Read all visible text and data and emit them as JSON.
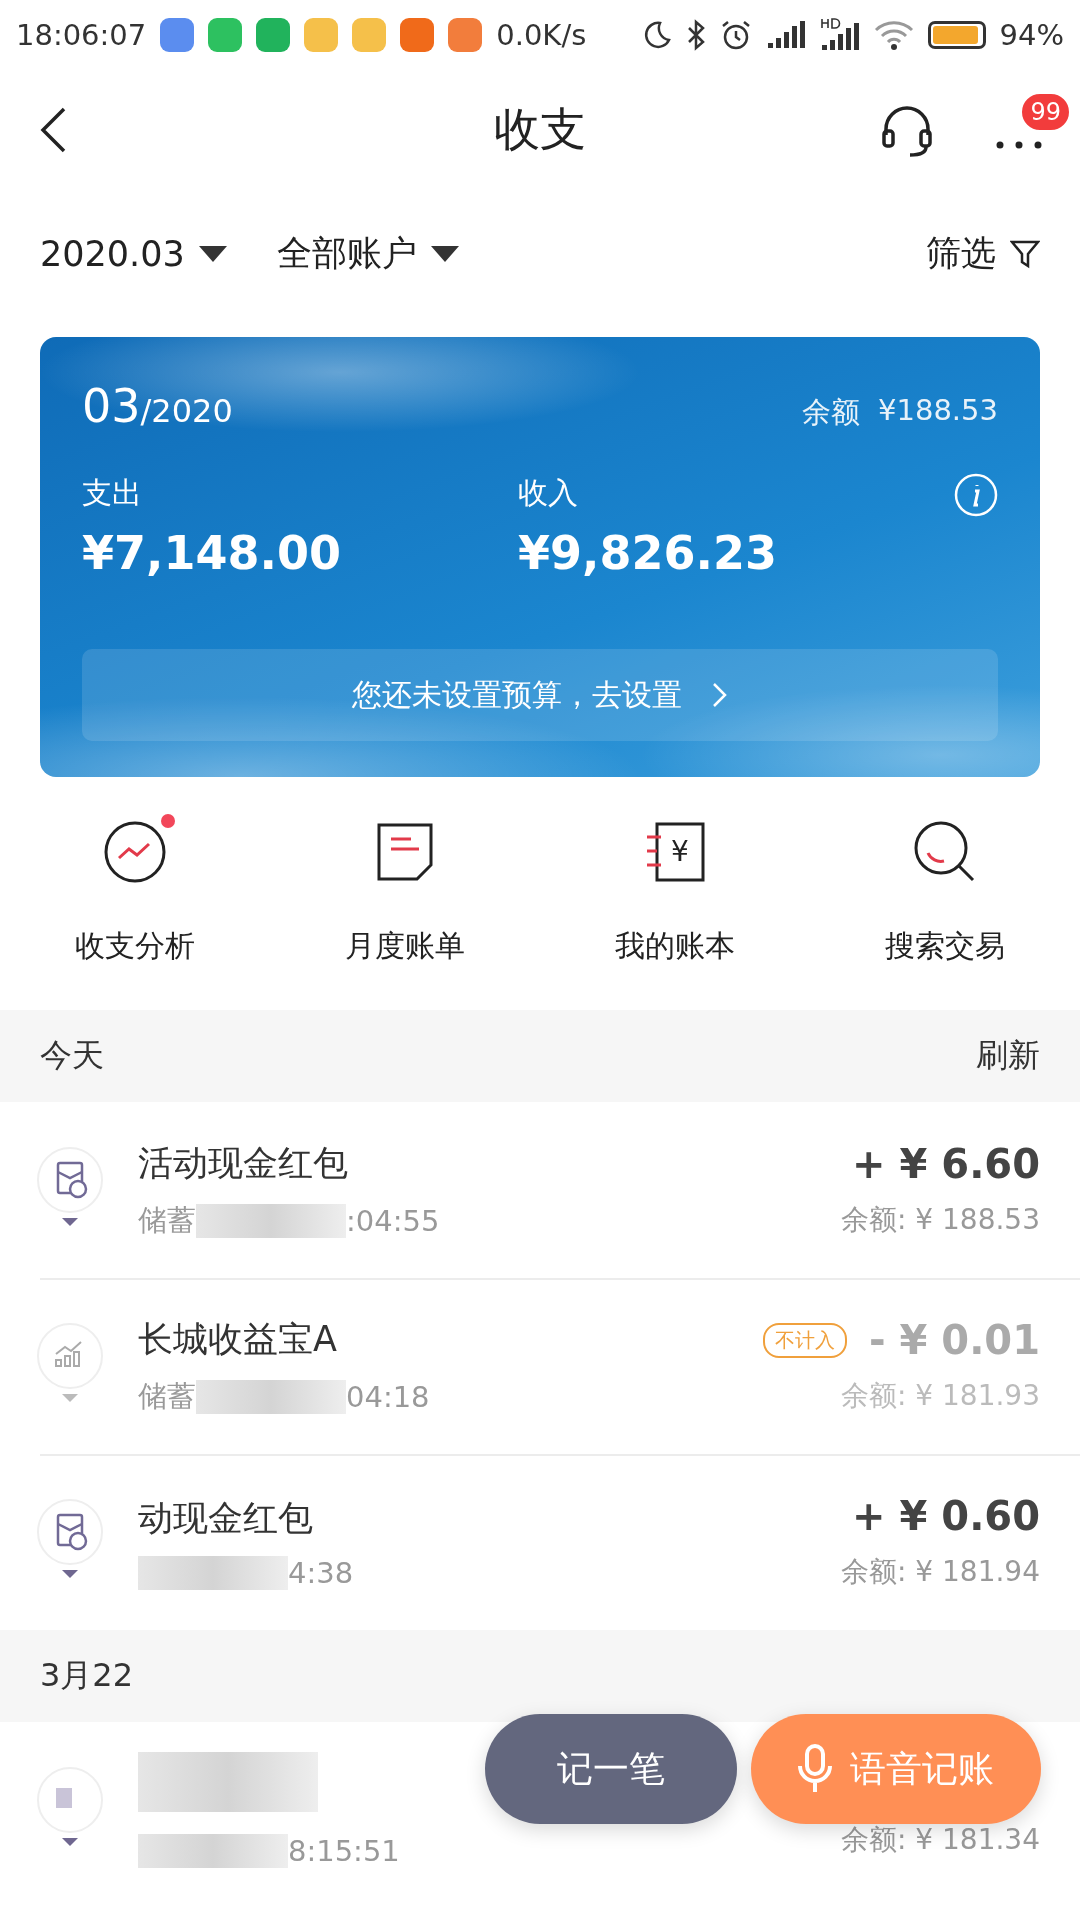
{
  "status_bar": {
    "time": "18:06:07",
    "speed": "0.0K/s",
    "battery_text": "94%",
    "battery": {
      "level": 0.94
    }
  },
  "header": {
    "title": "收支",
    "more_badge": "99"
  },
  "filters": {
    "month": "2020.03",
    "account": "全部账户",
    "filter_label": "筛选"
  },
  "summary": {
    "month": "03",
    "year": "/2020",
    "balance_label": "余额",
    "balance": "¥188.53",
    "expense_label": "支出",
    "expense": "¥7,148.00",
    "income_label": "收入",
    "income": "¥9,826.23",
    "budget_prompt": "您还未设置预算，去设置"
  },
  "quick_actions": [
    {
      "kind": "analysis",
      "label": "收支分析",
      "dot": true
    },
    {
      "kind": "bill",
      "label": "月度账单",
      "dot": false
    },
    {
      "kind": "ledger",
      "label": "我的账本",
      "dot": false,
      "icon_text": "¥"
    },
    {
      "kind": "search",
      "label": "搜索交易",
      "dot": false
    }
  ],
  "sections": [
    {
      "title": "今天",
      "action": "刷新",
      "transactions": [
        {
          "kind": "red-packet",
          "title": "活动现金红包",
          "account": "储蓄",
          "time": ":04:55",
          "amount": "+ ¥ 6.60",
          "balance": "余额: ¥ 188.53",
          "excluded": false
        },
        {
          "kind": "chart",
          "title": "长城收益宝A",
          "account": "储蓄",
          "time": "04:18",
          "tag": "不计入",
          "amount": "- ¥ 0.01",
          "balance": "余额: ¥ 181.93",
          "excluded": true
        },
        {
          "kind": "red-packet",
          "title": "动现金红包",
          "time": "4:38",
          "amount": "+ ¥ 0.60",
          "balance": "余额: ¥ 181.94",
          "excluded": false
        }
      ]
    },
    {
      "title": "3月22",
      "transactions": [
        {
          "kind": "note",
          "time": "8:15:51",
          "balance": "余额: ¥ 181.34",
          "excluded": false
        }
      ]
    }
  ],
  "fab_buttons": [
    {
      "kind": "plain",
      "label": "记一笔"
    },
    {
      "kind": "voice",
      "label": "语音记账"
    }
  ]
}
